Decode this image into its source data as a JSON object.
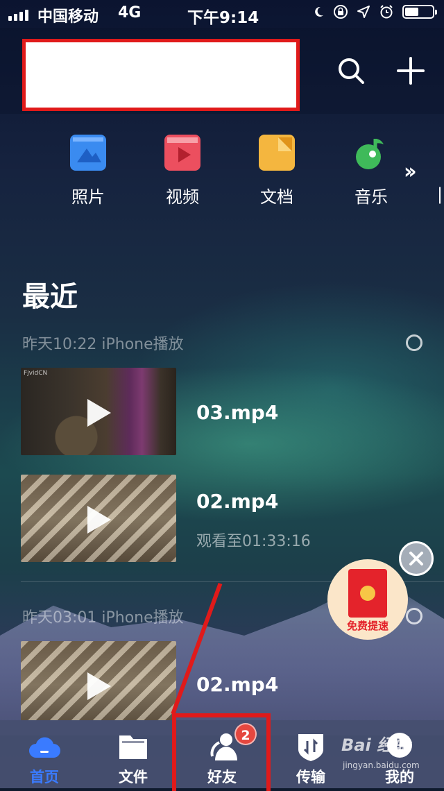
{
  "status_bar": {
    "carrier": "中国移动",
    "network": "4G",
    "time": "下午9:14",
    "battery_level": 0.5
  },
  "header": {
    "title": "",
    "search_icon": "search-icon",
    "add_icon": "plus-icon"
  },
  "quick_access": [
    {
      "label": "照片",
      "icon": "photo-icon",
      "color": "#3a8bf0"
    },
    {
      "label": "视频",
      "icon": "video-icon",
      "color": "#ec4f5f"
    },
    {
      "label": "文档",
      "icon": "document-icon",
      "color": "#f4b63f"
    },
    {
      "label": "音乐",
      "icon": "music-icon",
      "color": "#3fba5a"
    }
  ],
  "more_icon": "double-chevron-right-icon",
  "recent": {
    "title": "最近",
    "groups": [
      {
        "header": "昨天10:22 iPhone播放",
        "items": [
          {
            "name": "03.mp4",
            "subtitle": ""
          },
          {
            "name": "02.mp4",
            "subtitle": "观看至01:33:16"
          }
        ]
      },
      {
        "header": "昨天03:01 iPhone播放",
        "items": [
          {
            "name": "02.mp4",
            "subtitle": ""
          }
        ]
      }
    ]
  },
  "promo": {
    "text": "免费提速",
    "close_icon": "close-icon"
  },
  "tabs": [
    {
      "label": "首页",
      "icon": "cloud-icon",
      "active": true
    },
    {
      "label": "文件",
      "icon": "folder-icon",
      "active": false
    },
    {
      "label": "好友",
      "icon": "friends-icon",
      "active": false,
      "badge": "2"
    },
    {
      "label": "传输",
      "icon": "transfer-icon",
      "active": false
    },
    {
      "label": "我的",
      "icon": "profile-icon",
      "active": false
    }
  ],
  "watermark": {
    "logo": "Bai 经验",
    "site": "jingyan.baidu.com"
  },
  "colors": {
    "accent": "#3a7bff",
    "highlight": "#e01a1a",
    "badge": "#e5473f"
  }
}
